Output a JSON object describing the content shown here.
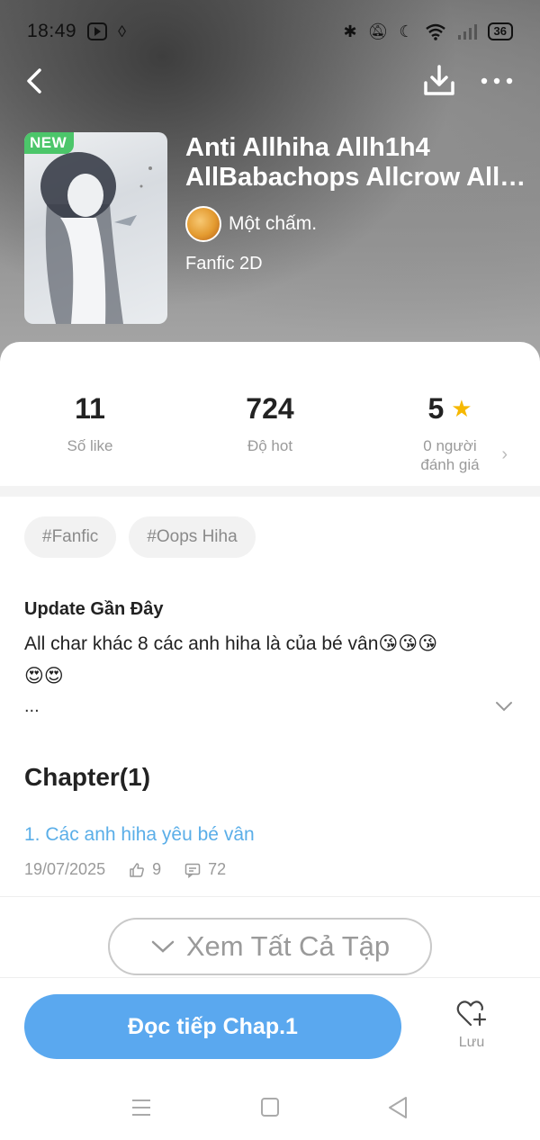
{
  "status_bar": {
    "time": "18:49",
    "battery": "36"
  },
  "book": {
    "badge": "NEW",
    "title_line1": "Anti Allhiha Allh1h4",
    "title_line2": "AllBabachops Allcrow AllbabaAllcrow",
    "author": "Một chấm.",
    "genre": "Fanfic 2D"
  },
  "stats": {
    "likes_value": "11",
    "likes_label": "Số like",
    "hot_value": "724",
    "hot_label": "Độ hot",
    "rating_value": "5",
    "rating_label_line1": "0 người",
    "rating_label_line2": "đánh giá"
  },
  "tags": [
    "#Fanfic",
    "#Oops Hiha"
  ],
  "update": {
    "title": "Update Gần Đây",
    "text_line1": "All char khác 8 các anh hiha là của bé vân😘😘😘",
    "text_line2": "😍😍",
    "ellipsis": "..."
  },
  "chapters": {
    "title": "Chapter(1)",
    "items": [
      {
        "label": "1. Các anh hiha yêu bé vân",
        "date": "19/07/2025",
        "likes": "9",
        "comments": "72"
      }
    ]
  },
  "see_all_label": "Xem Tất Cả Tập",
  "read_button_label": "Đọc tiếp Chap.1",
  "save_label": "Lưu",
  "colors": {
    "accent": "#5aa8ef",
    "link": "#5aaee8",
    "new_badge": "#4cc66a",
    "star": "#f6b800"
  },
  "icons": [
    "back-icon",
    "download-icon",
    "more-icon",
    "star-icon",
    "like-icon",
    "comment-icon",
    "heart-plus-icon",
    "chevron-down-icon",
    "menu-icon",
    "home-icon",
    "back-triangle-icon"
  ]
}
